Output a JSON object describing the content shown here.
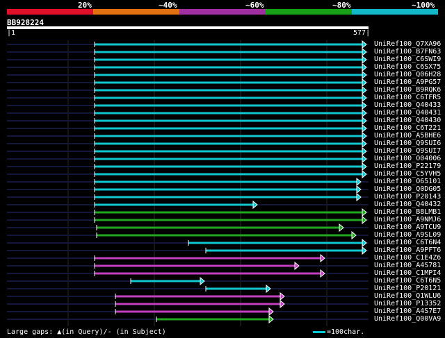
{
  "identity_legend": {
    "labels": [
      "20%",
      "~40%",
      "~60%",
      "~80%",
      "~100%"
    ],
    "colors": [
      "#e0102a",
      "#e07010",
      "#a030a0",
      "#18a018",
      "#10b8c8"
    ]
  },
  "query": {
    "id": "BB928224",
    "start": "1",
    "end": "577"
  },
  "hits": [
    {
      "name": "UniRef100_Q7XA96",
      "start": 136,
      "end": 527,
      "color": "cyan"
    },
    {
      "name": "UniRef100_B7FN63",
      "start": 136,
      "end": 527,
      "color": "cyan"
    },
    {
      "name": "UniRef100_C6SWI9",
      "start": 136,
      "end": 527,
      "color": "cyan"
    },
    {
      "name": "UniRef100_C6SX75",
      "start": 136,
      "end": 527,
      "color": "cyan"
    },
    {
      "name": "UniRef100_Q06H28",
      "start": 136,
      "end": 527,
      "color": "cyan"
    },
    {
      "name": "UniRef100_A9PG57",
      "start": 136,
      "end": 527,
      "color": "cyan"
    },
    {
      "name": "UniRef100_B9RQK6",
      "start": 136,
      "end": 527,
      "color": "cyan"
    },
    {
      "name": "UniRef100_C6TFR5",
      "start": 136,
      "end": 527,
      "color": "cyan"
    },
    {
      "name": "UniRef100_Q40433",
      "start": 136,
      "end": 527,
      "color": "cyan"
    },
    {
      "name": "UniRef100_Q40431",
      "start": 136,
      "end": 527,
      "color": "cyan"
    },
    {
      "name": "UniRef100_Q40430",
      "start": 136,
      "end": 527,
      "color": "cyan"
    },
    {
      "name": "UniRef100_C6T221",
      "start": 136,
      "end": 527,
      "color": "cyan"
    },
    {
      "name": "UniRef100_A5BHE6",
      "start": 136,
      "end": 527,
      "color": "cyan"
    },
    {
      "name": "UniRef100_Q9SUI6",
      "start": 136,
      "end": 527,
      "color": "cyan"
    },
    {
      "name": "UniRef100_Q9SUI7",
      "start": 136,
      "end": 527,
      "color": "cyan"
    },
    {
      "name": "UniRef100_O04006",
      "start": 136,
      "end": 527,
      "color": "cyan"
    },
    {
      "name": "UniRef100_P22179",
      "start": 136,
      "end": 527,
      "color": "cyan"
    },
    {
      "name": "UniRef100_C5YVH5",
      "start": 136,
      "end": 527,
      "color": "cyan"
    },
    {
      "name": "UniRef100_O65101",
      "start": 136,
      "end": 519,
      "color": "cyan"
    },
    {
      "name": "UniRef100_Q0DG05",
      "start": 136,
      "end": 519,
      "color": "cyan"
    },
    {
      "name": "UniRef100_P20143",
      "start": 136,
      "end": 519,
      "color": "cyan"
    },
    {
      "name": "UniRef100_Q40432",
      "start": 136,
      "end": 370,
      "color": "cyan"
    },
    {
      "name": "UniRef100_B8LMB1",
      "start": 136,
      "end": 527,
      "color": "green"
    },
    {
      "name": "UniRef100_A9NMJ6",
      "start": 136,
      "end": 527,
      "color": "green"
    },
    {
      "name": "UniRef100_A9TCU9",
      "start": 139,
      "end": 494,
      "color": "green"
    },
    {
      "name": "UniRef100_A9SL09",
      "start": 139,
      "end": 512,
      "color": "green"
    },
    {
      "name": "UniRef100_C6T6N4",
      "start": 271,
      "end": 527,
      "color": "cyan"
    },
    {
      "name": "UniRef100_A9PFT6",
      "start": 296,
      "end": 527,
      "color": "cyan"
    },
    {
      "name": "UniRef100_C1E4Z6",
      "start": 136,
      "end": 467,
      "color": "magenta"
    },
    {
      "name": "UniRef100_A4S781",
      "start": 136,
      "end": 430,
      "color": "magenta"
    },
    {
      "name": "UniRef100_C1MPI4",
      "start": 136,
      "end": 467,
      "color": "magenta"
    },
    {
      "name": "UniRef100_C6T6N5",
      "start": 188,
      "end": 294,
      "color": "cyan"
    },
    {
      "name": "UniRef100_P20121",
      "start": 296,
      "end": 389,
      "color": "cyan"
    },
    {
      "name": "UniRef100_Q1WLU6",
      "start": 166,
      "end": 409,
      "color": "magenta"
    },
    {
      "name": "UniRef100_P13352",
      "start": 166,
      "end": 409,
      "color": "magenta"
    },
    {
      "name": "UniRef100_A4S7E7",
      "start": 166,
      "end": 393,
      "color": "magenta"
    },
    {
      "name": "UniRef100_Q00VA9",
      "start": 225,
      "end": 393,
      "color": "green"
    }
  ],
  "colors": {
    "cyan": "#10c8d0",
    "green": "#20a820",
    "magenta": "#c040c0",
    "track": "#14163a",
    "grid": "#2a2a2a"
  },
  "footer": {
    "gaps_text": "Large gaps: ▲(in Query)/- (in Subject)",
    "scale_text": "=100char."
  }
}
